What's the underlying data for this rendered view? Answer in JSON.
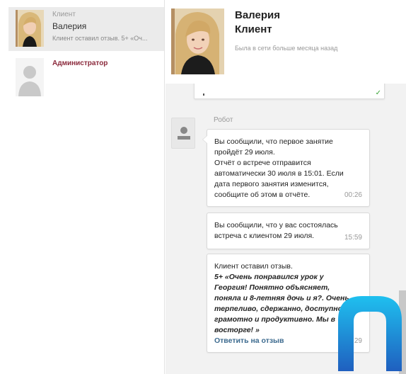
{
  "sidebar": {
    "contacts": [
      {
        "role": "Клиент",
        "name": "Валерия",
        "preview": "Клиент оставил отзыв. 5+ «Оч..."
      },
      {
        "label": "Администратор"
      }
    ]
  },
  "header": {
    "name_line1": "Валерия",
    "name_line2": "Клиент",
    "status": "Была в сети больше месяца назад"
  },
  "chat": {
    "sender": "Робот",
    "messages": [
      {
        "lines": [
          "Вы сообщили, что первое занятие",
          "пройдёт 29 июля.",
          "Отчёт о встрече отправится",
          "автоматически 30 июля в 15:01. Если",
          "дата первого занятия изменится,",
          "сообщите об этом в отчёте."
        ],
        "time": "00:26"
      },
      {
        "lines": [
          "Вы сообщили, что у вас состоялась",
          "встреча с клиентом 29 июля."
        ],
        "time": "15:59"
      },
      {
        "intro": "Клиент оставил отзыв.",
        "quote_lines": [
          "5+ «Очень понравился урок у",
          "Георгия! Понятно объясняет,",
          "поняла и 8-летняя дочь и я?. Очень",
          "терпеливо, сдержанно, доступно,",
          "грамотно и продуктивно. Мы в",
          "восторге! »"
        ],
        "reply_label": "Ответить на отзыв",
        "time": "15:29"
      }
    ]
  },
  "colors": {
    "admin_label": "#8b2a3c",
    "reply_link": "#3d6b8f",
    "check": "#3aa537",
    "logo_gradient_top": "#1fc0ef",
    "logo_gradient_bottom": "#1f5fbf"
  },
  "icons": {
    "check": "✓"
  }
}
